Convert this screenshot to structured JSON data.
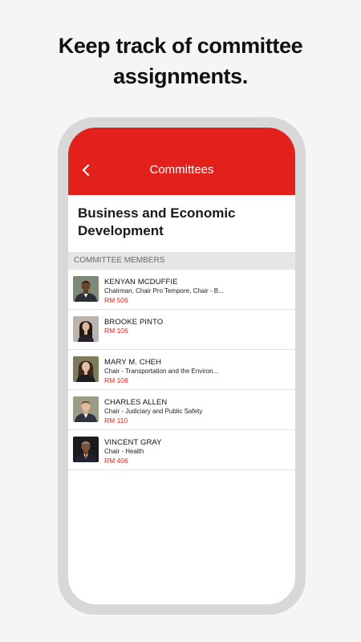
{
  "headline": {
    "line1": "Keep track of committee",
    "line2": "assignments."
  },
  "appbar": {
    "title": "Committees",
    "back_icon": "chevron-left-icon"
  },
  "committee": {
    "name": "Business and Economic Development"
  },
  "section": {
    "header": "COMMITTEE MEMBERS"
  },
  "colors": {
    "brand_red": "#e3211c",
    "background": "#f5f5f5",
    "phone_frame": "#d8d8d8"
  },
  "members": [
    {
      "name": "KENYAN MCDUFFIE",
      "role": "Chairman, Chair Pro Tempore, Chair - B...",
      "room": "RM 506"
    },
    {
      "name": "BROOKE PINTO",
      "role": "",
      "room": "RM 106"
    },
    {
      "name": "MARY M. CHEH",
      "role": "Chair - Transportation and the Environ...",
      "room": "RM 108"
    },
    {
      "name": "CHARLES ALLEN",
      "role": "Chair - Judiciary and Public Safety",
      "room": "RM 110"
    },
    {
      "name": "VINCENT GRAY",
      "role": "Chair - Health",
      "room": "RM 406"
    }
  ]
}
